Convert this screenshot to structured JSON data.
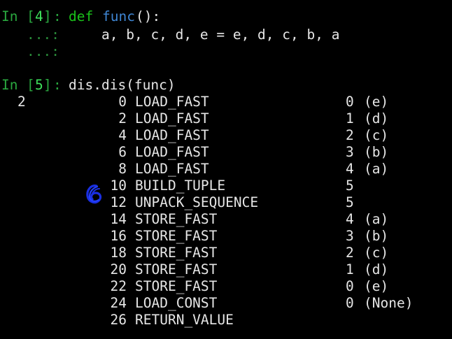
{
  "cells": [
    {
      "prompt": {
        "prefix": "In ",
        "open": "[",
        "num": "4",
        "close": "]",
        "colon": ":"
      },
      "lines": [
        {
          "kw": "def ",
          "fn": "func",
          "rest": "():"
        },
        {
          "cont": "...:",
          "text": "a, b, c, d, e = e, d, c, b, a"
        },
        {
          "cont": "...:",
          "text": ""
        }
      ]
    },
    {
      "prompt": {
        "prefix": "In ",
        "open": "[",
        "num": "5",
        "close": "]",
        "colon": ":"
      },
      "code": "dis.dis(func)"
    }
  ],
  "disassembly": {
    "line_number": "2",
    "rows": [
      {
        "offset": "0",
        "op": "LOAD_FAST",
        "arg": "0",
        "repr": "(e)"
      },
      {
        "offset": "2",
        "op": "LOAD_FAST",
        "arg": "1",
        "repr": "(d)"
      },
      {
        "offset": "4",
        "op": "LOAD_FAST",
        "arg": "2",
        "repr": "(c)"
      },
      {
        "offset": "6",
        "op": "LOAD_FAST",
        "arg": "3",
        "repr": "(b)"
      },
      {
        "offset": "8",
        "op": "LOAD_FAST",
        "arg": "4",
        "repr": "(a)"
      },
      {
        "offset": "10",
        "op": "BUILD_TUPLE",
        "arg": "5",
        "repr": ""
      },
      {
        "offset": "12",
        "op": "UNPACK_SEQUENCE",
        "arg": "5",
        "repr": ""
      },
      {
        "offset": "14",
        "op": "STORE_FAST",
        "arg": "4",
        "repr": "(a)"
      },
      {
        "offset": "16",
        "op": "STORE_FAST",
        "arg": "3",
        "repr": "(b)"
      },
      {
        "offset": "18",
        "op": "STORE_FAST",
        "arg": "2",
        "repr": "(c)"
      },
      {
        "offset": "20",
        "op": "STORE_FAST",
        "arg": "1",
        "repr": "(d)"
      },
      {
        "offset": "22",
        "op": "STORE_FAST",
        "arg": "0",
        "repr": "(e)"
      },
      {
        "offset": "24",
        "op": "LOAD_CONST",
        "arg": "0",
        "repr": "(None)"
      },
      {
        "offset": "26",
        "op": "RETURN_VALUE",
        "arg": "",
        "repr": ""
      }
    ]
  },
  "colors": {
    "background": "#000000",
    "text": "#e6e6e6",
    "prompt": "#2aa83f",
    "keyword": "#1ac21a",
    "function": "#3f86d4",
    "annotation": "#1a2fe0"
  }
}
